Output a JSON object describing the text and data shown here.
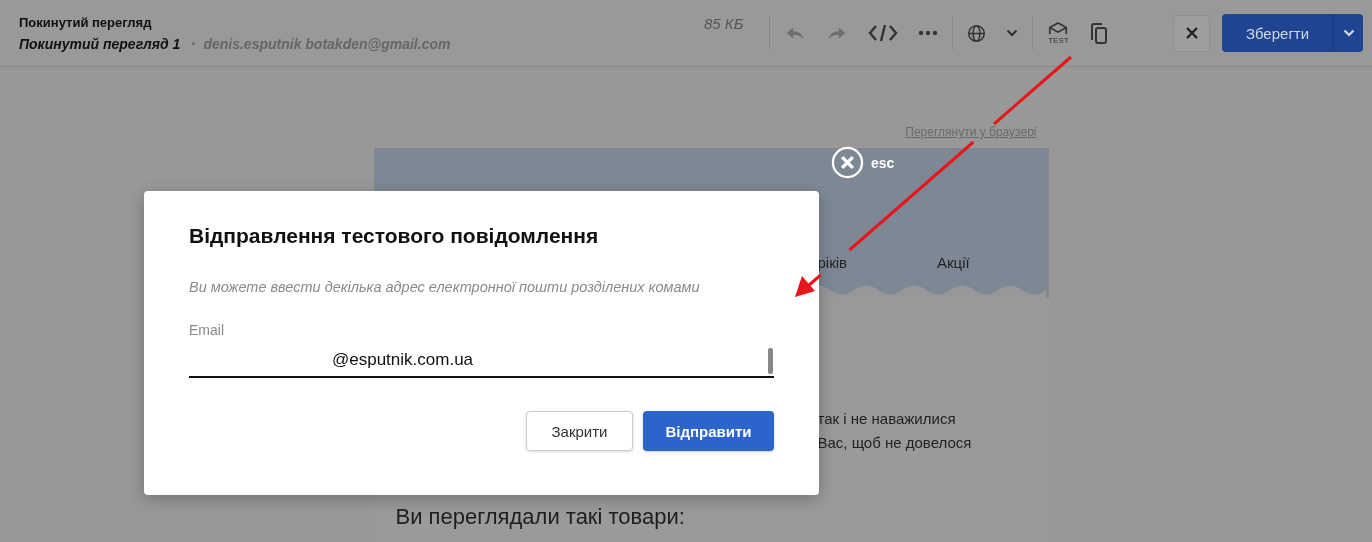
{
  "toolbar": {
    "title": "Покинутий перегляд",
    "subtitle": "Покинутий перегляд 1",
    "sender": "denis.esputnik botakden@gmail.com",
    "size": "85 КБ",
    "test_label": "TEST",
    "save_button": "Зберегти"
  },
  "email_preview": {
    "browser_link": "Переглянути у браузері",
    "nav": [
      "ріків",
      "Акції"
    ],
    "body_lines": [
      "так і не наважилися",
      "Вас, щоб не довелося"
    ],
    "section_title": "Ви переглядали такі товари:"
  },
  "close_overlay": {
    "label": "esc"
  },
  "dialog": {
    "title": "Відправлення тестового повідомлення",
    "hint": "Ви можете ввести декілька адрес електронної пошти розділених комами",
    "email_field": {
      "label": "Email",
      "value": "@esputnik.com.ua"
    },
    "buttons": [
      {
        "label": "Закрити",
        "kind": "secondary"
      },
      {
        "label": "Відправити",
        "kind": "primary"
      }
    ]
  }
}
